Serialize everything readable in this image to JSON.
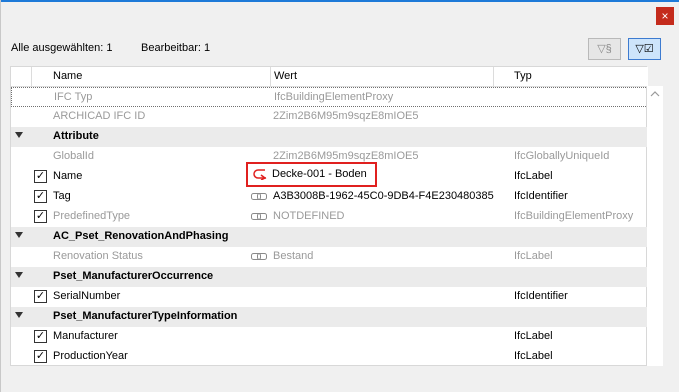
{
  "window": {
    "close_glyph": "×"
  },
  "info": {
    "selected_label": "Alle ausgewählten: 1",
    "editable_label": "Bearbeitbar: 1"
  },
  "toolbar": {
    "filter_paragraph": {
      "icon": "filter-paragraph-icon",
      "glyph": "▽§"
    },
    "filter_checked": {
      "icon": "filter-checked-icon",
      "glyph": "▽☑",
      "active": true
    }
  },
  "columns": {
    "name": "Name",
    "value": "Wert",
    "type": "Typ"
  },
  "rows": [
    {
      "kind": "prop",
      "name": "IFC Typ",
      "value": "IfcBuildingElementProxy",
      "type": "",
      "muted": true,
      "checkbox": false
    },
    {
      "kind": "prop",
      "name": "ARCHICAD IFC ID",
      "value": "2Zim2B6M95m9sqzE8mIOE5",
      "type": "",
      "muted": true,
      "checkbox": false
    },
    {
      "kind": "group",
      "name": "Attribute"
    },
    {
      "kind": "prop",
      "name": "GlobalId",
      "value": "2Zim2B6M95m9sqzE8mIOE5",
      "type": "IfcGloballyUniqueId",
      "muted": true,
      "checkbox": false
    },
    {
      "kind": "prop",
      "name": "Name",
      "value": "Decke-001 - Boden",
      "type": "IfcLabel",
      "muted": false,
      "checkbox": true,
      "highlight": true
    },
    {
      "kind": "prop",
      "name": "Tag",
      "value": "A3B3008B-1962-45C0-9DB4-F4E230480385",
      "type": "IfcIdentifier",
      "muted": false,
      "checkbox": true,
      "link": true
    },
    {
      "kind": "prop",
      "name": "PredefinedType",
      "value": "NOTDEFINED",
      "type": "IfcBuildingElementProxy",
      "muted": true,
      "checkbox": true,
      "link": true
    },
    {
      "kind": "group",
      "name": "AC_Pset_RenovationAndPhasing"
    },
    {
      "kind": "prop",
      "name": "Renovation Status",
      "value": "Bestand",
      "type": "IfcLabel",
      "muted": true,
      "checkbox": false,
      "link": true
    },
    {
      "kind": "group",
      "name": "Pset_ManufacturerOccurrence"
    },
    {
      "kind": "prop",
      "name": "SerialNumber",
      "value": "",
      "type": "IfcIdentifier",
      "muted": false,
      "checkbox": true
    },
    {
      "kind": "group",
      "name": "Pset_ManufacturerTypeInformation"
    },
    {
      "kind": "prop",
      "name": "Manufacturer",
      "value": "",
      "type": "IfcLabel",
      "muted": false,
      "checkbox": true
    },
    {
      "kind": "prop",
      "name": "ProductionYear",
      "value": "",
      "type": "IfcLabel",
      "muted": false,
      "checkbox": true
    }
  ],
  "colors": {
    "highlight_border": "#e0201f",
    "accent": "#1e7ad8",
    "group_bg": "#ebebeb"
  }
}
